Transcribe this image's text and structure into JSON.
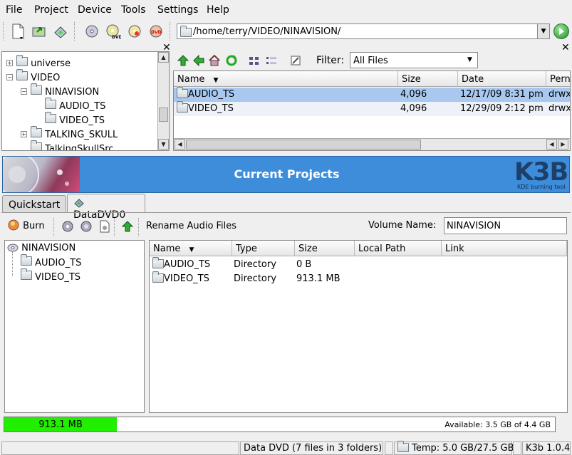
{
  "menu": {
    "file": "File",
    "project": "Project",
    "device": "Device",
    "tools": "Tools",
    "settings": "Settings",
    "help": "Help"
  },
  "location": {
    "path": "/home/terry/VIDEO/NINAVISION/"
  },
  "top_tree": {
    "items": [
      {
        "label": "universe"
      },
      {
        "label": "VIDEO"
      },
      {
        "label": "NINAVISION"
      },
      {
        "label": "AUDIO_TS"
      },
      {
        "label": "VIDEO_TS"
      },
      {
        "label": "TALKING_SKULL"
      },
      {
        "label": "TalkingSkullSrc"
      }
    ]
  },
  "browser": {
    "filter_label": "Filter:",
    "filter_value": "All Files",
    "columns": {
      "name": "Name",
      "size": "Size",
      "date": "Date",
      "perm": "Pern"
    },
    "rows": [
      {
        "name": "AUDIO_TS",
        "size": "4,096",
        "date": "12/17/09 8:31 pm",
        "perm": "drwx"
      },
      {
        "name": "VIDEO_TS",
        "size": "4,096",
        "date": "12/29/09 2:12 pm",
        "perm": "drwx"
      }
    ]
  },
  "banner": {
    "title": "Current Projects",
    "logo": "K3B",
    "logo_sub": "KDE burning tool"
  },
  "tabs": {
    "quickstart": "Quickstart",
    "datadvd": "DataDVD0"
  },
  "project": {
    "burn": "Burn",
    "rename": "Rename Audio Files",
    "volume_label": "Volume Name:",
    "volume_value": "NINAVISION",
    "tree": {
      "root": "NINAVISION",
      "children": [
        {
          "label": "AUDIO_TS"
        },
        {
          "label": "VIDEO_TS"
        }
      ]
    },
    "columns": {
      "name": "Name",
      "type": "Type",
      "size": "Size",
      "local_path": "Local Path",
      "link": "Link"
    },
    "rows": [
      {
        "name": "AUDIO_TS",
        "type": "Directory",
        "size": "0 B"
      },
      {
        "name": "VIDEO_TS",
        "type": "Directory",
        "size": "913.1 MB"
      }
    ]
  },
  "capacity": {
    "used": "913.1 MB",
    "available": "Available: 3.5 GB of 4.4 GB",
    "fill_fraction": 0.205,
    "color": "#22ee00"
  },
  "status": {
    "project": "Data DVD (7 files in 3 folders)",
    "temp": "Temp: 5.0 GB/27.5 GB",
    "version": "K3b 1.0.4"
  }
}
